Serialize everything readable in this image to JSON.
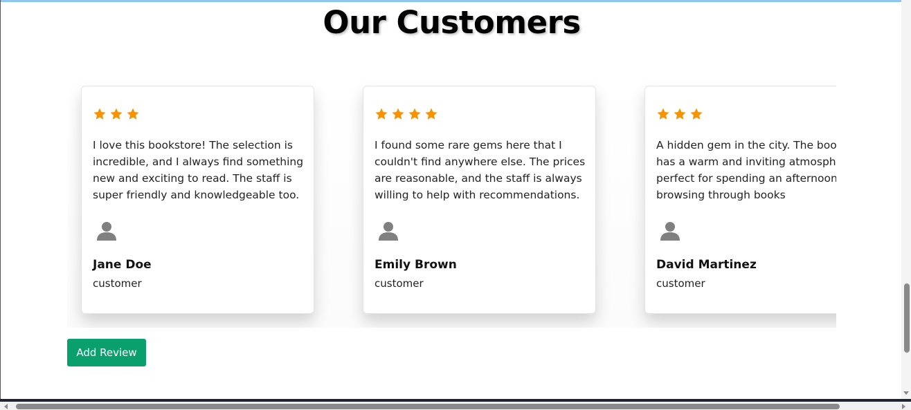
{
  "section": {
    "title": "Our Customers"
  },
  "colors": {
    "star": "#f59400",
    "button": "#0aa06e",
    "avatar": "#808080",
    "accent_top": "#8ec8f2"
  },
  "reviews": [
    {
      "rating": 3,
      "text": "I love this bookstore! The selection is incredible, and I always find something new and exciting to read. The staff is super friendly and knowledgeable too.",
      "avatar_icon": "user-icon",
      "name": "Jane Doe",
      "role": "customer"
    },
    {
      "rating": 4,
      "text": "I found some rare gems here that I couldn't find anywhere else. The prices are reasonable, and the staff is always willing to help with recommendations.",
      "avatar_icon": "user-icon",
      "name": "Emily Brown",
      "role": "customer"
    },
    {
      "rating": 3,
      "text_lines": [
        "A hidden gem in the city. The bookst",
        "has a warm and inviting atmosphere,",
        "perfect for spending an afternoon",
        "browsing through books"
      ],
      "avatar_icon": "user-icon",
      "name": "David Martinez",
      "role": "customer"
    }
  ],
  "actions": {
    "add_review_label": "Add Review"
  }
}
